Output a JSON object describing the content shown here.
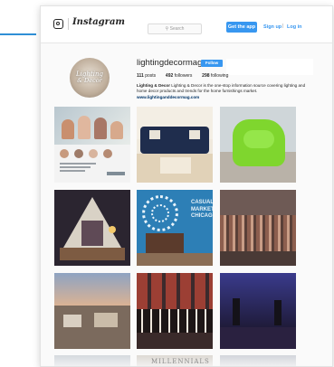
{
  "nav": {
    "wordmark": "Instagram",
    "search_placeholder": "Search",
    "get_app_label": "Get the app",
    "signup_label": "Sign up",
    "separator": "|",
    "login_label": "Log in"
  },
  "profile": {
    "avatar_text_line1": "Lighting",
    "avatar_text_line2": "& Decor",
    "username": "lightingdecormag",
    "follow_label": "Follow",
    "stats": {
      "posts_count": "111",
      "posts_label": "posts",
      "followers_count": "492",
      "followers_label": "followers",
      "following_count": "298",
      "following_label": "following"
    },
    "bio_name": "Lighting & Decor",
    "bio_text": " Lighting & Decor is the one-stop information source covering lighting and home decor products and trends for the home furnishings market.",
    "bio_link": "www.lightinganddecormag.com"
  },
  "tiles": {
    "t5_text": "CASUAL MARKET CHICAGO",
    "bottom_text": "MILLENNIALS"
  },
  "colors": {
    "accent": "#3897f0",
    "link": "#003569",
    "outer_line": "#2f8fd6"
  }
}
